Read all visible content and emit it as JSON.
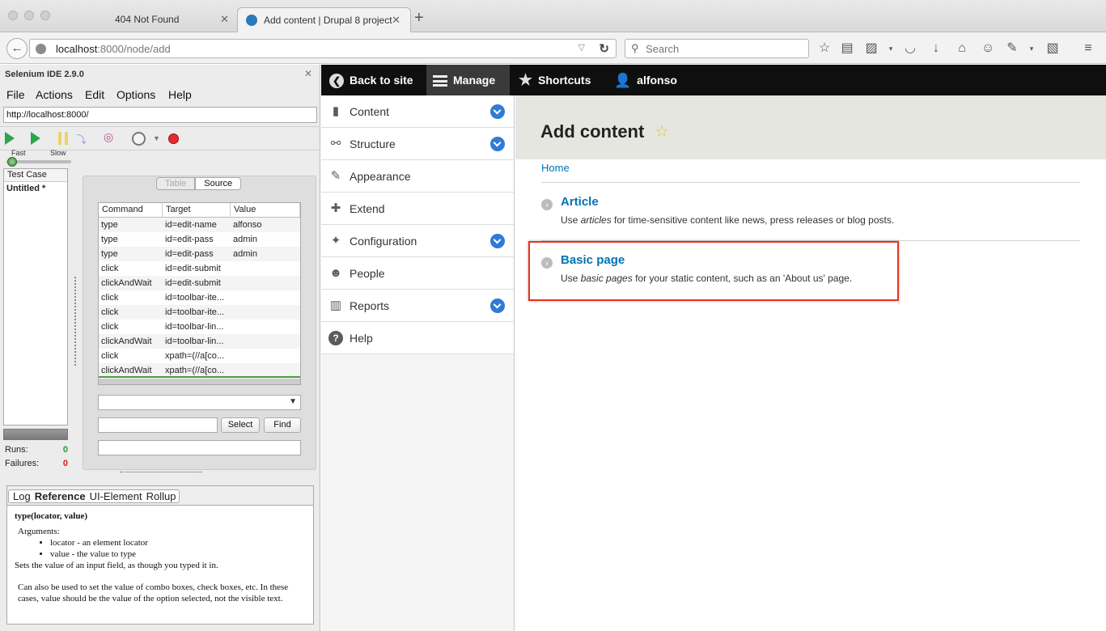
{
  "browser": {
    "tabs": [
      {
        "title": "404 Not Found",
        "active": false
      },
      {
        "title": "Add content | Drupal 8 project",
        "active": true
      }
    ],
    "url_host": "localhost",
    "url_rest": ":8000/node/add",
    "search_placeholder": "Search"
  },
  "selenium": {
    "title": "Selenium IDE 2.9.0",
    "menu": [
      "File",
      "Actions",
      "Edit",
      "Options",
      "Help"
    ],
    "base_url": "http://localhost:8000/",
    "speed_fast": "Fast",
    "speed_slow": "Slow",
    "testcase_header": "Test Case",
    "testcase_item": "Untitled *",
    "runs_label": "Runs:",
    "runs_value": "0",
    "failures_label": "Failures:",
    "failures_value": "0",
    "view_tabs": {
      "table": "Table",
      "source": "Source"
    },
    "columns": [
      "Command",
      "Target",
      "Value"
    ],
    "rows": [
      [
        "type",
        "id=edit-name",
        "alfonso"
      ],
      [
        "type",
        "id=edit-pass",
        "admin"
      ],
      [
        "type",
        "id=edit-pass",
        "admin"
      ],
      [
        "click",
        "id=edit-submit",
        ""
      ],
      [
        "clickAndWait",
        "id=edit-submit",
        ""
      ],
      [
        "click",
        "id=toolbar-ite...",
        ""
      ],
      [
        "click",
        "id=toolbar-ite...",
        ""
      ],
      [
        "click",
        "id=toolbar-lin...",
        ""
      ],
      [
        "clickAndWait",
        "id=toolbar-lin...",
        ""
      ],
      [
        "click",
        "xpath=(//a[co...",
        ""
      ],
      [
        "clickAndWait",
        "xpath=(//a[co...",
        ""
      ]
    ],
    "select_button": "Select",
    "find_button": "Find",
    "ref_tabs": [
      "Log",
      "Reference",
      "UI-Element",
      "Rollup"
    ],
    "ref": {
      "signature": "type(locator, value)",
      "arguments_label": "Arguments:",
      "arg1": "locator - an element locator",
      "arg2": "value - the value to type",
      "summary": "Sets the value of an input field, as though you typed it in.",
      "detail": "Can also be used to set the value of combo boxes, check boxes, etc. In these cases, value should be the value of the option selected, not the visible text."
    }
  },
  "drupal": {
    "toolbar": {
      "back": "Back to site",
      "manage": "Manage",
      "shortcuts": "Shortcuts",
      "user": "alfonso"
    },
    "tray": [
      {
        "label": "Content",
        "icon": "content-icon",
        "expandable": true
      },
      {
        "label": "Structure",
        "icon": "structure-icon",
        "expandable": true
      },
      {
        "label": "Appearance",
        "icon": "appearance-icon",
        "expandable": false
      },
      {
        "label": "Extend",
        "icon": "extend-icon",
        "expandable": false
      },
      {
        "label": "Configuration",
        "icon": "configuration-icon",
        "expandable": true
      },
      {
        "label": "People",
        "icon": "people-icon",
        "expandable": false
      },
      {
        "label": "Reports",
        "icon": "reports-icon",
        "expandable": true
      },
      {
        "label": "Help",
        "icon": "help-icon",
        "expandable": false
      }
    ],
    "page_title": "Add content",
    "breadcrumb": "Home",
    "types": [
      {
        "title": "Article",
        "pre": "Use ",
        "em": "articles",
        "post": " for time-sensitive content like news, press releases or blog posts."
      },
      {
        "title": "Basic page",
        "pre": "Use ",
        "em": "basic pages",
        "post": " for your static content, such as an 'About us' page."
      }
    ],
    "colors": {
      "link": "#0073b5",
      "highlight": "#e8321f",
      "toolbar": "#0f0f0f"
    }
  }
}
